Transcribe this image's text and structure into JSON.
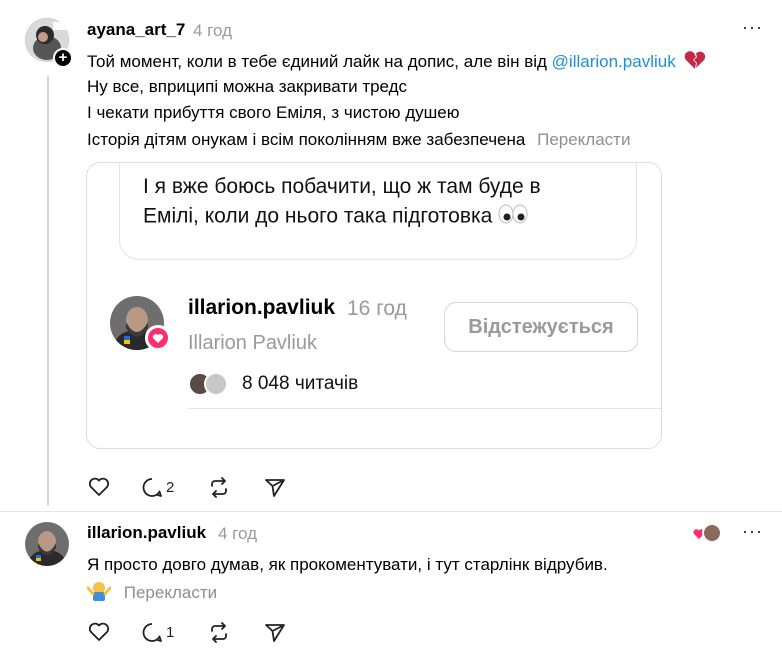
{
  "post": {
    "username": "ayana_art_7",
    "time": "4 год",
    "line1_text": "Той момент, коли в тебе єдиний лайк на допис, але він від ",
    "line1_mention": "@illarion.pavliuk",
    "line2": "Ну все, вприципі можна закривати тредс",
    "line3": "І чекати прибуття свого Еміля, з чистою душею",
    "line4": "Історія дітям онукам і всім поколінням вже забезпечена",
    "translate": "Перекласти",
    "quote": {
      "line1": "І я вже боюсь побачити, що ж там буде в",
      "line2": "Емілі, коли до нього така підготовка"
    },
    "profile_card": {
      "username": "illarion.pavliuk",
      "time": "16 год",
      "full_name": "Illarion Pavliuk",
      "follow_label": "Відстежується",
      "readers": "8 048 читачів"
    },
    "actions": {
      "comments": "2"
    }
  },
  "reply": {
    "username": "illarion.pavliuk",
    "time": "4 год",
    "text": "Я просто довго думав, як прокоментувати, і тут старлінк відрубив.",
    "translate": "Перекласти",
    "actions": {
      "comments": "1"
    }
  },
  "colors": {
    "mention": "#1d8fd8",
    "secondary": "#9a9a9a",
    "like_badge": "#ff2d6f",
    "broken_heart": "#c62848"
  },
  "icons": [
    "more-icon",
    "heart-icon",
    "comment-icon",
    "repost-icon",
    "share-icon",
    "broken-heart-icon",
    "eyes-emoji",
    "shrug-emoji",
    "plus-badge-icon",
    "like-badge-icon"
  ]
}
